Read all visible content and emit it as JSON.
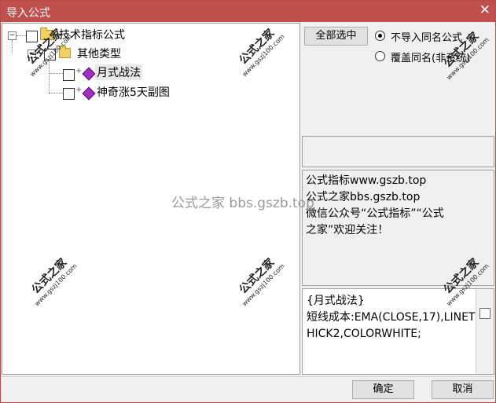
{
  "window": {
    "title": "导入公式"
  },
  "tree": {
    "root_label": "技术指标公式",
    "group_label": "其他类型",
    "items": [
      {
        "label": "月式战法"
      },
      {
        "label": "神奇涨5天副图"
      }
    ]
  },
  "options": {
    "select_all_label": "全部选中",
    "radio_skip_label": "不导入同名公式",
    "radio_overwrite_label": "覆盖同名(非系统)",
    "selected_radio": "skip"
  },
  "info": {
    "lines": [
      "公式指标www.gszb.top",
      "公式之家bbs.gszb.top",
      "微信公众号“公式指标”“公式",
      "之家”欢迎关注！"
    ]
  },
  "code": {
    "text": "{月式战法}\n短线成本:EMA(CLOSE,17),LINETHICK2,COLORWHITE;"
  },
  "buttons": {
    "ok_label": "确定",
    "cancel_label": "取消"
  },
  "watermark": {
    "center_text": "公式之家 bbs.gszb.top",
    "stamp_big": "公式之家",
    "stamp_small": "www.gszj100.com"
  }
}
